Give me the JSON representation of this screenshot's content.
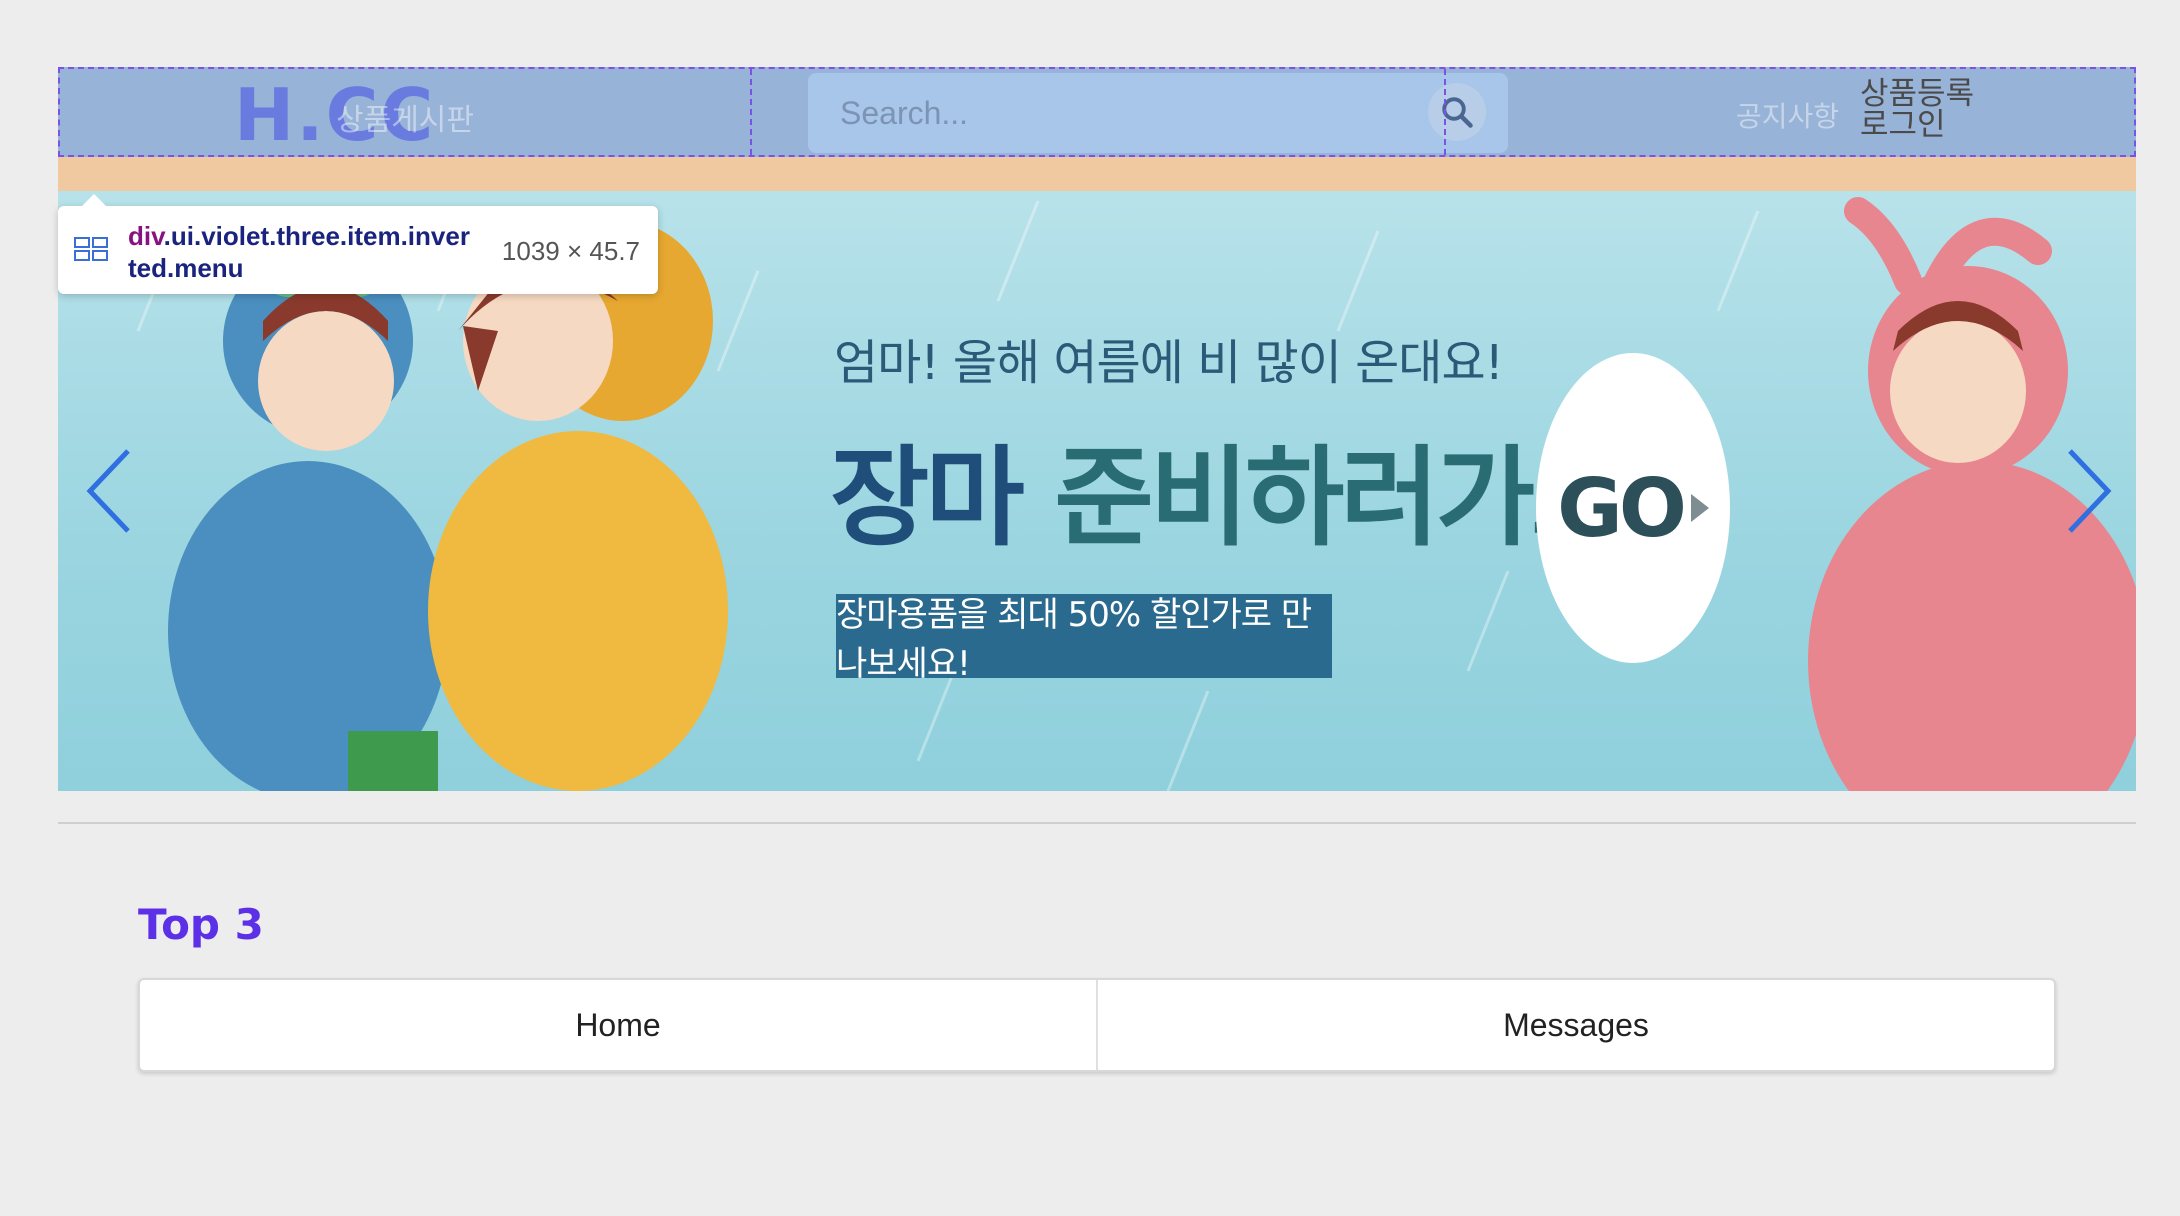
{
  "header": {
    "logo": "H.CC",
    "board_link": "상품게시판",
    "search": {
      "placeholder": "Search..."
    },
    "notice_link": "공지사항",
    "register_link": "상품등록",
    "login_link": "로그인"
  },
  "tooltip": {
    "tag": "div",
    "selector": ".ui.violet.three.item.inverted.menu",
    "size": "1039 × 45.7"
  },
  "banner": {
    "subtitle": "엄마! 올해 여름에 비 많이 온대요!",
    "title_first": "장마",
    "title_rest": " 준비하러가요!",
    "cta": "장마용품을 최대 50% 할인가로 만나보세요!",
    "go_label": "GO"
  },
  "section": {
    "title": "Top 3",
    "tabs": [
      {
        "label": "Home"
      },
      {
        "label": "Messages"
      }
    ]
  },
  "colors": {
    "menu_overlay": "#98b3d8",
    "accent_violet": "#5b30e6",
    "orange_strip": "#f0c9a0",
    "carousel_arrow": "#2f6fe0"
  }
}
